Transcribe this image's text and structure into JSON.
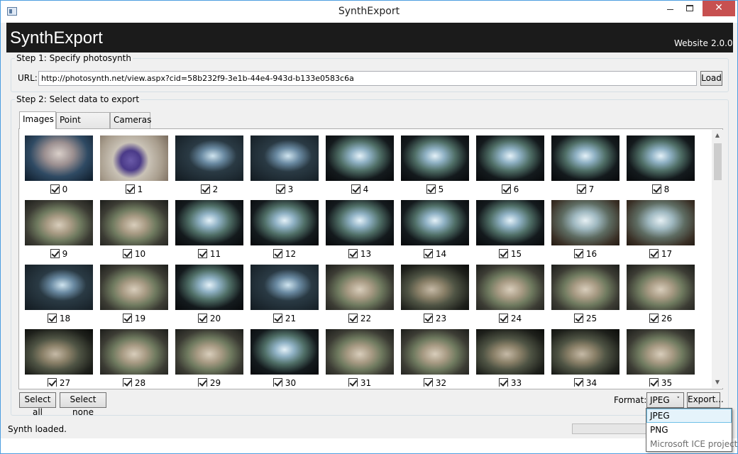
{
  "window": {
    "title": "SynthExport"
  },
  "header": {
    "brand": "SynthExport",
    "website_link": "Website",
    "version": "2.0.0"
  },
  "step1": {
    "legend": "Step 1: Specify photosynth",
    "url_label": "URL:",
    "url_value": "http://photosynth.net/view.aspx?cid=58b232f9-3e1b-44e4-943d-b133e0583c6a",
    "load_label": "Load"
  },
  "step2": {
    "legend": "Step 2: Select data to export",
    "tabs": [
      {
        "label": "Images",
        "active": true
      },
      {
        "label": "Point clouds",
        "active": false
      },
      {
        "label": "Cameras",
        "active": false
      }
    ],
    "images": [
      {
        "n": "0",
        "checked": true,
        "theme": "rock"
      },
      {
        "n": "1",
        "checked": true,
        "theme": "purple"
      },
      {
        "n": "2",
        "checked": true,
        "theme": "tank-dark"
      },
      {
        "n": "3",
        "checked": true,
        "theme": "tank-dark"
      },
      {
        "n": "4",
        "checked": true,
        "theme": "tank"
      },
      {
        "n": "5",
        "checked": true,
        "theme": "tank"
      },
      {
        "n": "6",
        "checked": true,
        "theme": "tank"
      },
      {
        "n": "7",
        "checked": true,
        "theme": "tank"
      },
      {
        "n": "8",
        "checked": true,
        "theme": "tank"
      },
      {
        "n": "9",
        "checked": true,
        "theme": "coral"
      },
      {
        "n": "10",
        "checked": true,
        "theme": "coral"
      },
      {
        "n": "11",
        "checked": true,
        "theme": "tank"
      },
      {
        "n": "12",
        "checked": true,
        "theme": "tank"
      },
      {
        "n": "13",
        "checked": true,
        "theme": "tank"
      },
      {
        "n": "14",
        "checked": true,
        "theme": "tank"
      },
      {
        "n": "15",
        "checked": true,
        "theme": "tank"
      },
      {
        "n": "16",
        "checked": true,
        "theme": "room"
      },
      {
        "n": "17",
        "checked": true,
        "theme": "room"
      },
      {
        "n": "18",
        "checked": true,
        "theme": "tank-dark"
      },
      {
        "n": "19",
        "checked": true,
        "theme": "coral"
      },
      {
        "n": "20",
        "checked": true,
        "theme": "tank"
      },
      {
        "n": "21",
        "checked": true,
        "theme": "tank-dark"
      },
      {
        "n": "22",
        "checked": true,
        "theme": "coral"
      },
      {
        "n": "23",
        "checked": true,
        "theme": "coral-dark"
      },
      {
        "n": "24",
        "checked": true,
        "theme": "coral"
      },
      {
        "n": "25",
        "checked": true,
        "theme": "coral"
      },
      {
        "n": "26",
        "checked": true,
        "theme": "coral"
      },
      {
        "n": "27",
        "checked": true,
        "theme": "coral-dark"
      },
      {
        "n": "28",
        "checked": true,
        "theme": "coral"
      },
      {
        "n": "29",
        "checked": true,
        "theme": "coral"
      },
      {
        "n": "30",
        "checked": true,
        "theme": "tank"
      },
      {
        "n": "31",
        "checked": true,
        "theme": "coral"
      },
      {
        "n": "32",
        "checked": true,
        "theme": "coral"
      },
      {
        "n": "33",
        "checked": true,
        "theme": "coral-dark"
      },
      {
        "n": "34",
        "checked": true,
        "theme": "coral-dark"
      },
      {
        "n": "35",
        "checked": true,
        "theme": "coral"
      }
    ],
    "select_all_label": "Select all",
    "select_none_label": "Select none",
    "format_label": "Format:",
    "format_value": "JPEG",
    "export_label": "Export...",
    "format_options": [
      {
        "label": "JPEG",
        "state": "selected"
      },
      {
        "label": "PNG",
        "state": "normal"
      },
      {
        "label": "Microsoft ICE project",
        "state": "disabled"
      }
    ]
  },
  "status": {
    "text": "Synth loaded.",
    "progress": 0
  },
  "colors": {
    "header_bg": "#1b1b1b",
    "close_button": "#c75050",
    "window_border": "#4d9ee0",
    "dropdown_highlight": "#e5f3fb"
  }
}
